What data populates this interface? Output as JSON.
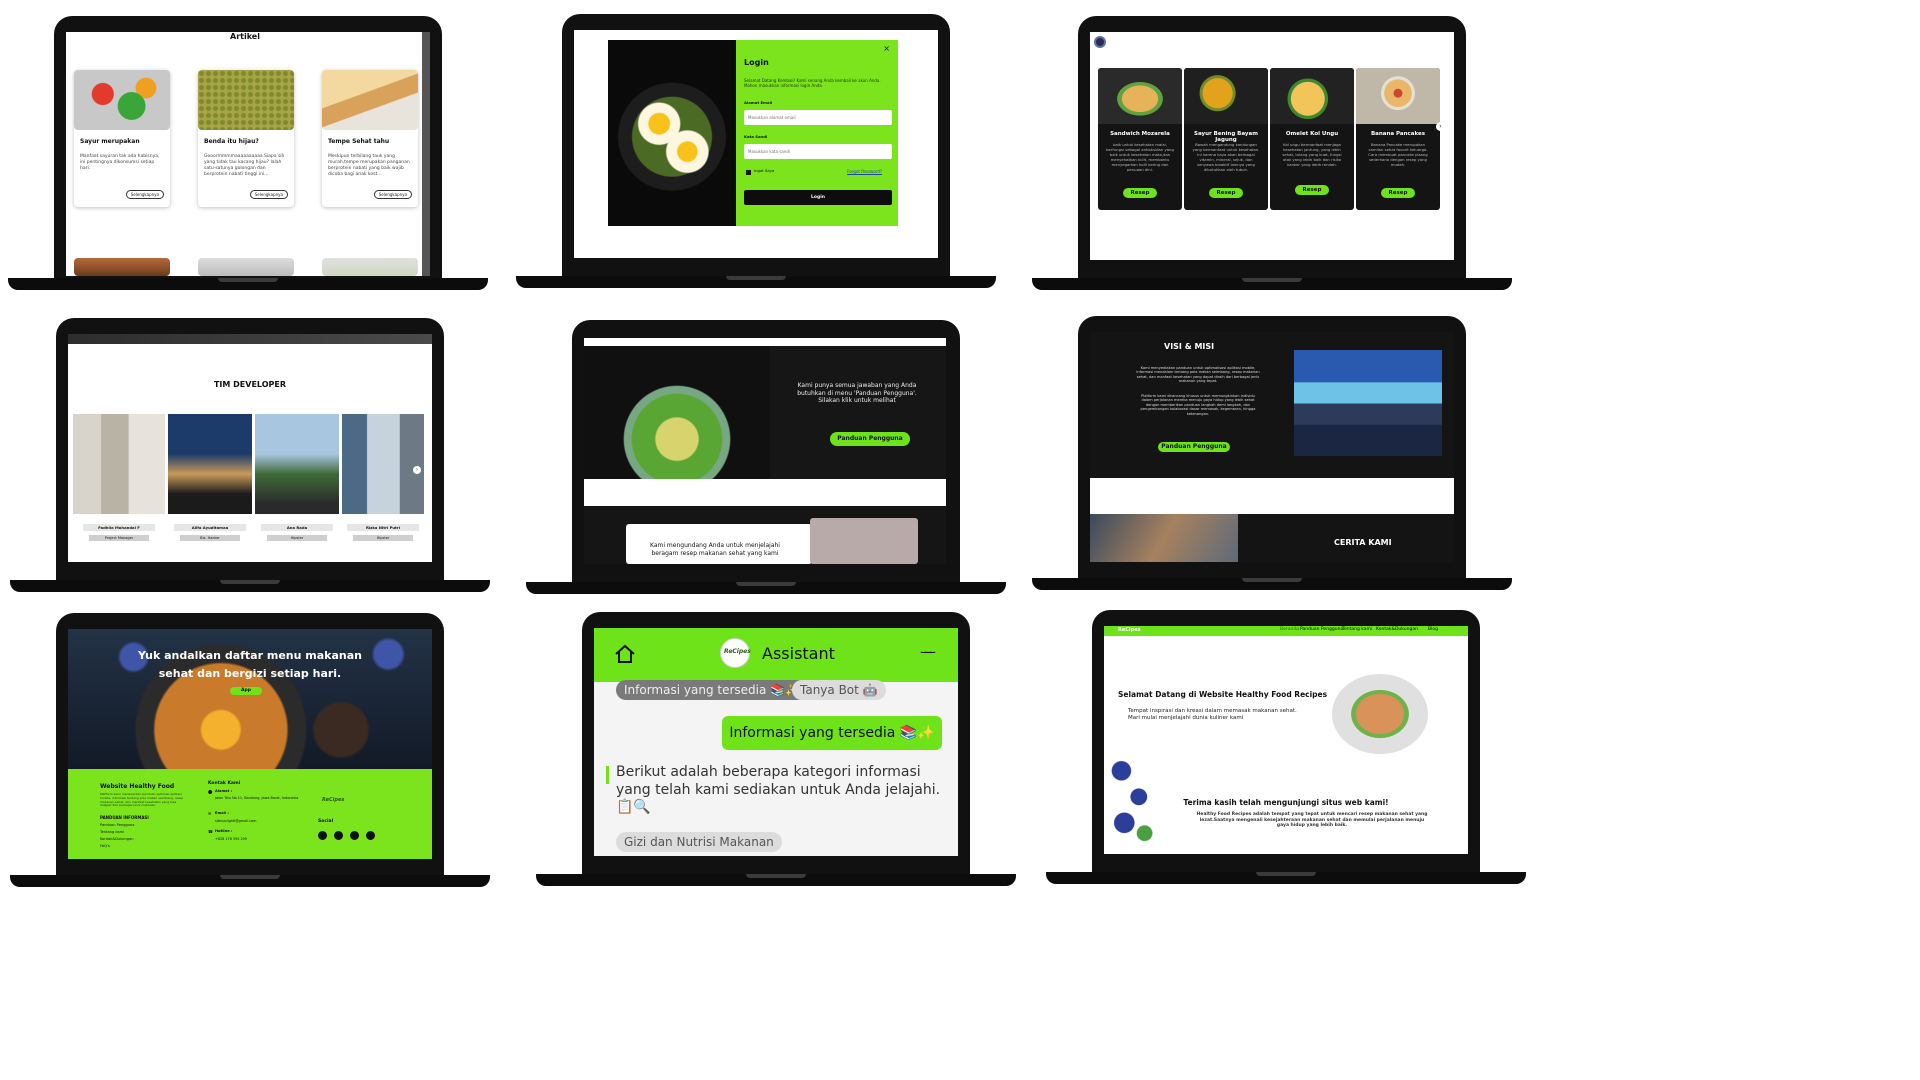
{
  "screen1": {
    "heading": "Artikel",
    "cards": [
      {
        "title": "Sayur merupakan",
        "desc": "Manfaat sayuran tak ada habisnya, ini pentingnya dikonsumsi setiap hari.",
        "more": "Selengkapnya"
      },
      {
        "title": "Benda itu hijau?",
        "desc": "Gooormmmmaaaaaaaaaa Siapa sih yang tidak tau kacang hijau? Ialah satu-satunya golongan dan berprotein nabati tinggi ini...",
        "more": "Selengkapnya"
      },
      {
        "title": "Tempe Sehat tahu",
        "desc": "Meskipun terbilang tauk yang murah,tempe merupakan panganan berprotein nabati yang baik wajib dicoba bagi anak kost...",
        "more": "Selengkapnya"
      }
    ]
  },
  "screen2": {
    "title": "Login",
    "close": "×",
    "intro": "Selamat Datang Kembali! Kami senang Anda kembali ke akun Anda. Mohon masukkan informasi login Anda.",
    "email_label": "Alamat Email",
    "email_placeholder": "Masukkan alamat email",
    "password_label": "Kata Sandi",
    "password_placeholder": "Masukkan kata sandi",
    "remember": "Ingat Saya",
    "forgot": "Forgot Password?",
    "login_button": "Login"
  },
  "screen3": {
    "recipes": [
      {
        "title": "Sandwich Mozarela",
        "desc": "baik untuk kesehatan malai, berfungsi sebagai antioksidan yang baik untuk kesehatan mata,dan menyehatkan kulit, membantu menyegarkan kulit kering dan penuaan dini.",
        "button": "Resep"
      },
      {
        "title": "Sayur Bening Bayam Jagung",
        "desc": "Bawah mengandung kandungan yang bermanfaat untuk kesehatan. Ini karena kaya akan berbagai vitamin, mineral, sejuk, dan senyawa bioaktif lainnya yang dibutuhkan oleh tubuh.",
        "button": "Resep"
      },
      {
        "title": "Omelet Kol Ungu",
        "desc": "Kol ungu bermanfaat menjaga kesehatan jantung, yang lebih sehat, tulang yang kuat, fungsi otak yang lebih baik dan risiko kanker yang lebih rendah.",
        "button": "Resep"
      },
      {
        "title": "Banana Pancakes",
        "desc": "Banana Pancake merupakan camilan sehat favorit keluarga. Cara membuat pancake pisang sederhana dengan resep yang mudah.",
        "button": "Resep"
      }
    ]
  },
  "screen4": {
    "heading": "TIM DEVELOPER",
    "members": [
      {
        "name": "Fadhila Mohandai F",
        "role": "Project Manager"
      },
      {
        "name": "Alifa Ayuditamaa",
        "role": "Biz. Hacker"
      },
      {
        "name": "Ana Rada",
        "role": "Hipster"
      },
      {
        "name": "Rizka Nitri Putri",
        "role": "Hipster"
      }
    ]
  },
  "screen5": {
    "message": "Kami punya semua jawaban yang Anda butuhkan di menu 'Panduan Pengguna'. Silakan klik untuk melihat",
    "button": "Panduan Pengguna",
    "invite": "Kami mengundang Anda untuk menjelajahi beragam resep makanan sehat yang kami"
  },
  "screen6": {
    "heading": "VISI & MISI",
    "para1": "Kami menyediakan panduan untuk optimalisasi aplikasi mobile, informasi mendalam tentang pola makan seimbang, resep makanan sehat, dan manfaat kesehatan yang dapat diraih dari berbagai jenis makanan yang tepat.",
    "para2": "Platform kami dirancang khusus untuk memungkinkan individu dalam perjalanan mereka menuju gaya hidup yang lebih sehat dengan memberikan panduan langkah demi langkah, dan pengembangan kolaborasi dasar memasak, kegemaran, hingga ketenangan.",
    "button": "Panduan Pengguna",
    "story": "CERITA KAMI"
  },
  "screen7": {
    "headline1": "Yuk andalkan daftar menu makanan",
    "headline2": "sehat dan bergizi setiap hari.",
    "app_button": "App",
    "footer_title": "Website  Healthy Food",
    "footer_desc": "Platform kami menawarkan panduan optimasi aplikasi mobile, informasi tentang pola makan seimbang, resep makanan sehat, dan manfaat kesehatan yang bisa didapat dari berbagai jenis makanan.",
    "panduan_title": "PANDUAN INFORMASI",
    "links": [
      "Panduan Pengguna",
      "Tentang kami",
      "Kontak&Dukungan",
      "FAQ's"
    ],
    "contact_title": "Kontak Kami",
    "address_label": "Alamat :",
    "address": "Jalan Telu No 11, Bandung, Jawa Barat, Indonesia",
    "email_label": "Email :",
    "email": "sitesuslighti@gmail.com",
    "phone_label": "Hotline :",
    "phone": "+628 176 590 209",
    "logo": "ReCipes",
    "social": "Social"
  },
  "screen8": {
    "title": "Assistant",
    "logo": "ReCipes",
    "minimize": "—",
    "chip_active": "Informasi yang tersedia 📚✨",
    "chip_bot": "Tanya Bot 🤖",
    "user_message": "Informasi yang tersedia 📚✨",
    "bot_message": "Berikut adalah beberapa kategori informasi yang telah kami sediakan untuk Anda jelajahi. 📋🔍",
    "option": "Gizi dan Nutrisi Makanan"
  },
  "screen9": {
    "brand": "ReCipes",
    "nav": [
      "Beranda",
      "Panduan Pengguna",
      "Tentang kami",
      "Kontak&Dukungan",
      "Blog"
    ],
    "welcome_title": "Selamat Datang di Website Healthy Food Recipes",
    "welcome_text": "Tempat inspirasi dan kreasi dalam memasak makanan sehat. Mari mulai menjelajahi dunia kuliner kami",
    "thanks_title": "Terima kasih telah mengunjungi situs web kami!",
    "thanks_text": "Healthy Food Recipes adalah tempat yang tepat untuk mencari resep makanan sehat yang lezat.Saatnya mengenali kesejahteraan makanan sehat dan memulai perjalanan menuju gaya hidup yang lebih baik."
  },
  "colors": {
    "green": "#6ee31a",
    "dark": "#141414"
  }
}
